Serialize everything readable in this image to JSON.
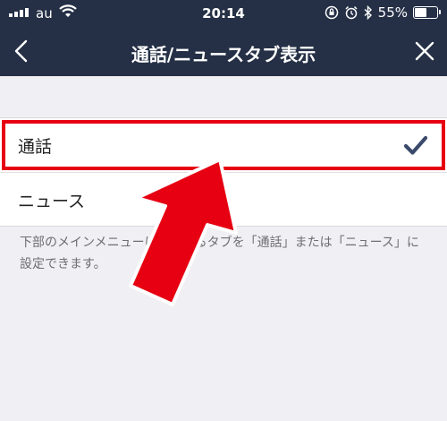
{
  "status_bar": {
    "carrier": "au",
    "time": "20:14",
    "battery": "55%",
    "battery_level": 0.55
  },
  "header": {
    "title": "通話/ニュースタブ表示"
  },
  "options": [
    {
      "label": "通話",
      "selected": true
    },
    {
      "label": "ニュース",
      "selected": false
    }
  ],
  "footnote": "下部のメインメニューに表示するタブを「通話」または「ニュース」に設定できます。",
  "colors": {
    "header_bg": "#253046",
    "check": "#3b4a6b",
    "highlight": "#e60012"
  }
}
